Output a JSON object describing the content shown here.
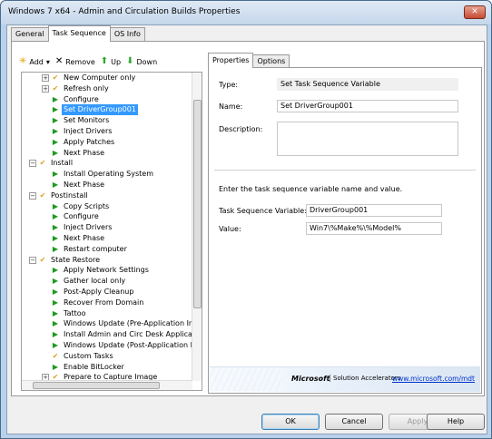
{
  "window": {
    "title": "Windows 7 x64 - Admin and Circulation Builds Properties",
    "close_glyph": "✕"
  },
  "outer_tabs": [
    {
      "label": "General"
    },
    {
      "label": "Task Sequence",
      "active": true
    },
    {
      "label": "OS Info"
    }
  ],
  "toolbar": {
    "add": {
      "label": "Add",
      "icon": "add-star-icon",
      "glyph": "✳",
      "color": "#d9a300"
    },
    "dropdown_glyph": "▾",
    "remove": {
      "label": "Remove",
      "icon": "remove-x-icon",
      "glyph": "✕"
    },
    "up": {
      "label": "Up",
      "icon": "up-arrow-icon",
      "glyph": "⬆",
      "color": "#2aa82a"
    },
    "down": {
      "label": "Down",
      "icon": "down-arrow-icon",
      "glyph": "⬇",
      "color": "#2aa82a"
    }
  },
  "tree": [
    {
      "label": "New Computer only",
      "depth": 1,
      "type": "group",
      "expander": "+"
    },
    {
      "label": "Refresh only",
      "depth": 1,
      "type": "group",
      "expander": "+"
    },
    {
      "label": "Configure",
      "depth": 1,
      "type": "step"
    },
    {
      "label": "Set DriverGroup001",
      "depth": 1,
      "type": "step",
      "selected": true
    },
    {
      "label": "Set Monitors",
      "depth": 1,
      "type": "step"
    },
    {
      "label": "Inject Drivers",
      "depth": 1,
      "type": "step"
    },
    {
      "label": "Apply Patches",
      "depth": 1,
      "type": "step"
    },
    {
      "label": "Next Phase",
      "depth": 1,
      "type": "step"
    },
    {
      "label": "Install",
      "depth": 0,
      "type": "group",
      "expander": "−"
    },
    {
      "label": "Install Operating System",
      "depth": 1,
      "type": "step"
    },
    {
      "label": "Next Phase",
      "depth": 1,
      "type": "step"
    },
    {
      "label": "Postinstall",
      "depth": 0,
      "type": "group",
      "expander": "−"
    },
    {
      "label": "Copy Scripts",
      "depth": 1,
      "type": "step"
    },
    {
      "label": "Configure",
      "depth": 1,
      "type": "step"
    },
    {
      "label": "Inject Drivers",
      "depth": 1,
      "type": "step"
    },
    {
      "label": "Next Phase",
      "depth": 1,
      "type": "step"
    },
    {
      "label": "Restart computer",
      "depth": 1,
      "type": "step"
    },
    {
      "label": "State Restore",
      "depth": 0,
      "type": "group",
      "expander": "−"
    },
    {
      "label": "Apply Network Settings",
      "depth": 1,
      "type": "step"
    },
    {
      "label": "Gather local only",
      "depth": 1,
      "type": "step"
    },
    {
      "label": "Post-Apply Cleanup",
      "depth": 1,
      "type": "step"
    },
    {
      "label": "Recover From Domain",
      "depth": 1,
      "type": "step"
    },
    {
      "label": "Tattoo",
      "depth": 1,
      "type": "step"
    },
    {
      "label": "Windows Update (Pre-Application Inst",
      "depth": 1,
      "type": "step"
    },
    {
      "label": "Install Admin and Circ Desk Applicatio",
      "depth": 1,
      "type": "step"
    },
    {
      "label": "Windows Update (Post-Application Ins",
      "depth": 1,
      "type": "step"
    },
    {
      "label": "Custom Tasks",
      "depth": 1,
      "type": "group"
    },
    {
      "label": "Enable BitLocker",
      "depth": 1,
      "type": "step"
    },
    {
      "label": "Prepare to Capture Image",
      "depth": 1,
      "type": "group",
      "expander": "+"
    }
  ],
  "icons": {
    "step": "▶",
    "group": "✔"
  },
  "colors": {
    "step": "#1e9a1e",
    "group": "#e0a020",
    "selection": "#3399ff",
    "link": "#0033cc"
  },
  "inner_tabs": [
    {
      "label": "Properties",
      "active": true
    },
    {
      "label": "Options"
    }
  ],
  "properties": {
    "type_label": "Type:",
    "type_value": "Set Task Sequence Variable",
    "name_label": "Name:",
    "name_value": "Set DriverGroup001",
    "description_label": "Description:",
    "description_value": "",
    "instructions": "Enter the task sequence variable name and value.",
    "variable_label": "Task Sequence Variable:",
    "variable_value": "DriverGroup001",
    "value_label": "Value:",
    "value_value": "Win7\\%Make%\\%Model%"
  },
  "banner": {
    "microsoft": "Microsoft",
    "solution_accelerators": "Solution Accelerators",
    "link": "www.microsoft.com/mdt"
  },
  "buttons": {
    "ok": "OK",
    "cancel": "Cancel",
    "apply": "Apply",
    "help": "Help"
  }
}
